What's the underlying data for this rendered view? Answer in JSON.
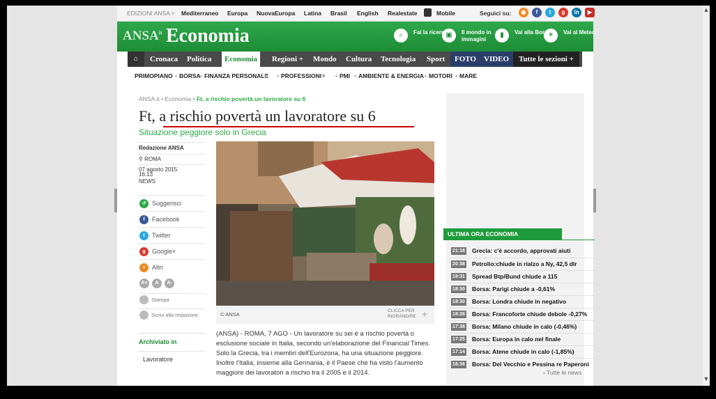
{
  "topbar": {
    "edition": "EDIZIONI ANSA >",
    "links": [
      "Mediterraneo",
      "Europa",
      "NuovaEuropa",
      "Latina",
      "Brasil",
      "English",
      "Realestate",
      "Mobile"
    ],
    "follow": "Seguici su:"
  },
  "header": {
    "logo": "ANSA",
    "logo_suffix": "it",
    "section": "Economia",
    "tools": [
      {
        "icon": "search-icon",
        "label": "Fai la ricerca"
      },
      {
        "icon": "world-images-icon",
        "label": "Il mondo in immagini"
      },
      {
        "icon": "chart-icon",
        "label": "Vai alla Borsa"
      },
      {
        "icon": "weather-icon",
        "label": "Vai al Meteo"
      }
    ]
  },
  "nav": {
    "items": [
      "Cronaca",
      "Politica",
      "Economia",
      "Regioni +",
      "Mondo",
      "Cultura",
      "Tecnologia",
      "Sport",
      "FOTO",
      "VIDEO",
      "Tutte le sezioni +"
    ],
    "active": "Economia"
  },
  "subnav": [
    "PRIMOPIANO",
    "BORSA",
    "FINANZA PERSONALE",
    "PROFESSIONI",
    "PMI",
    "AMBIENTE & ENERGIA",
    "MOTORI",
    "MARE"
  ],
  "breadcrumb": {
    "root": "ANSA.it",
    "section": "Economia",
    "current": "Ft, a rischio povertà un lavoratore su 6"
  },
  "article": {
    "title": "Ft, a rischio povertà un lavoratore su 6",
    "subtitle": "Situazione peggiore solo in Grecia",
    "author": "Redazione ANSA",
    "location": "ROMA",
    "date": "07 agosto 2015",
    "time": "16:13",
    "type": "NEWS",
    "photo_credit": "© ANSA",
    "enlarge": "CLICCA PER INGRANDIRE",
    "body": "(ANSA) - ROMA, 7 AGO - Un lavoratore su sei è a rischio povertà o esclusione sociale in Italia, secondo un'elaborazione del Financial Times. Solo la Grecia, tra i membri dell'Eurozona, ha una situazione peggiore. Inoltre l'Italia, insieme alla Germania, è il Paese che ha visto l'aumento maggiore dei lavoratori a rischio tra il 2005 e il 2014."
  },
  "share": [
    {
      "icon": "suggest-icon",
      "label": "Suggerisci",
      "color": "#2ea84a"
    },
    {
      "icon": "facebook-icon",
      "label": "Facebook",
      "color": "#3b5998"
    },
    {
      "icon": "twitter-icon",
      "label": "Twitter",
      "color": "#2aa9e0"
    },
    {
      "icon": "googleplus-icon",
      "label": "Google+",
      "color": "#d63a2e"
    },
    {
      "icon": "more-icon",
      "label": "Altri",
      "color": "#f08a24"
    }
  ],
  "font_buttons": [
    "A+",
    "A",
    "A-"
  ],
  "tools_small": {
    "print": "Stampa",
    "write": "Scrivi alla redazione"
  },
  "archive": {
    "title": "Archiviato in",
    "item": "Lavoratore"
  },
  "latest": {
    "title": "ULTIMA ORA ECONOMIA",
    "items": [
      {
        "time": "21:18",
        "text": "Grecia: c'è accordo, approvati aiuti"
      },
      {
        "time": "20:38",
        "text": "Petrolio:chiude in rialzo a Ny, 42,5 dlr"
      },
      {
        "time": "18:31",
        "text": "Spread Btp/Bund chiude a 115"
      },
      {
        "time": "18:30",
        "text": "Borsa: Parigi chiude a -0,61%"
      },
      {
        "time": "18:30",
        "text": "Borsa: Londra chiude in negativo"
      },
      {
        "time": "18:28",
        "text": "Borsa: Francoforte chiude debole -0,27%"
      },
      {
        "time": "17:38",
        "text": "Borsa: Milano chiude in calo (-0,46%)"
      },
      {
        "time": "17:25",
        "text": "Borsa: Europa in calo nel finale"
      },
      {
        "time": "17:14",
        "text": "Borsa: Atene chiude in calo (-1,85%)"
      },
      {
        "time": "16:36",
        "text": "Borsa: Del Vecchio e Pessina re Paperoni"
      }
    ],
    "more": "› Tutte le news"
  }
}
